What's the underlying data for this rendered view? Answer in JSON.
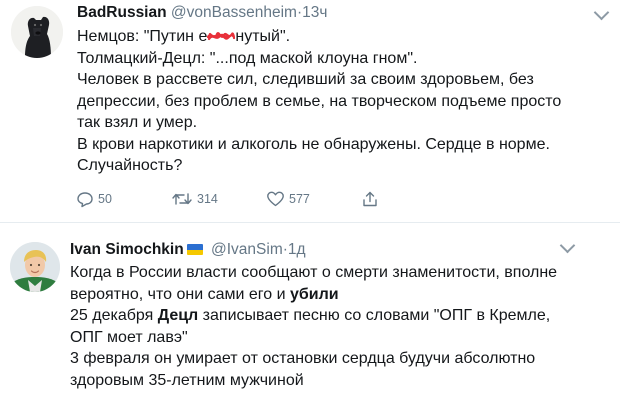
{
  "tweet1": {
    "name": "BadRussian",
    "handle": "@vonBassenheim",
    "separator": "·",
    "time": "13ч",
    "lines": [
      {
        "text": "Немцов: \"Путин е",
        "after": "нутый\"."
      },
      {
        "text": "Толмацкий-Децл: \"...под маской клоуна гном\"."
      },
      {
        "text": "Человек в рассвете сил, следивший за своим здоровьем, без"
      },
      {
        "text": "депрессии, без проблем в семье, на творческом подъеме просто"
      },
      {
        "text": "так взял и умер."
      },
      {
        "text": "В крови наркотики и алкоголь не обнаружены. Сердце в норме."
      },
      {
        "text": "Случайность?"
      }
    ],
    "actions": {
      "reply_count": "50",
      "retweet_count": "314",
      "like_count": "577"
    }
  },
  "tweet2": {
    "name": "Ivan Simochkin",
    "handle": "@IvanSim",
    "separator": "·",
    "time": "1д",
    "lines": {
      "l1": "Когда в России власти сообщают о смерти знаменитости, вполне",
      "l2a": "вероятно, что они сами его и ",
      "l2b": "убили",
      "l3a": "25 декабря ",
      "l3b": "Децл",
      "l3c": " записывает песню со словами \"ОПГ в Кремле,",
      "l4": "ОПГ моет лавэ\"",
      "l5": "3 февраля он умирает от остановки сердца будучи абсолютно",
      "l6": "здоровым 35-летним мужчиной"
    }
  },
  "colors": {
    "text": "#14171a",
    "secondary": "#657786",
    "divider": "#e6ecf0",
    "scribble": "#e8303a",
    "flag_blue": "#2b6fd1",
    "flag_yellow": "#f5c800"
  }
}
